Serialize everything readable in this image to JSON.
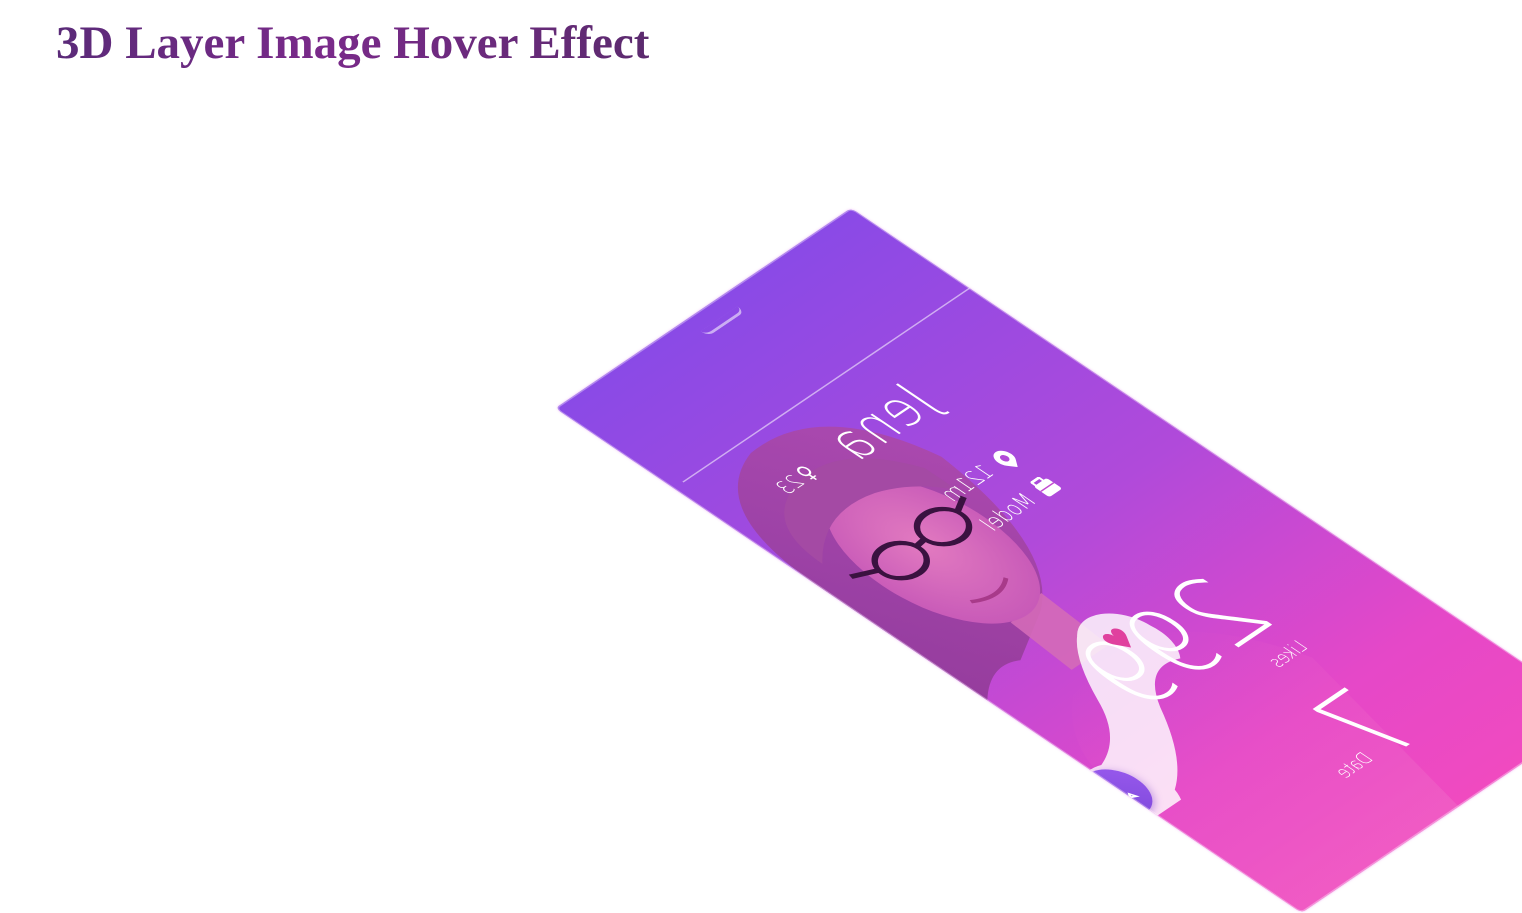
{
  "page": {
    "title": "3D Layer Image Hover Effect"
  },
  "profile_card": {
    "name": "Jena",
    "age": "23",
    "distance": "121m",
    "occupation": "Model",
    "likes_count": "299",
    "likes_label": "Likes",
    "date_count": "7",
    "date_label": "Date",
    "icons": {
      "gender": "female-icon",
      "location": "location-pin-icon",
      "occupation": "briefcase-icon",
      "like": "heart-icon",
      "chat": "chat-bubble-icon"
    },
    "colors": {
      "gradient_top": "#8a4ae6",
      "gradient_bottom": "#f04ac0",
      "title_color": "#6a2a80",
      "heart_color": "#e0409e",
      "chat_button_color": "#8a50e6"
    }
  }
}
